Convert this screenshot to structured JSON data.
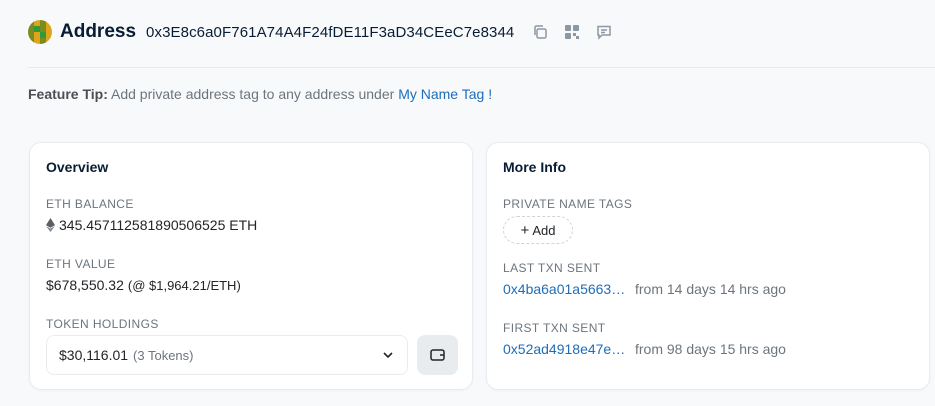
{
  "header": {
    "title": "Address",
    "address": "0x3E8c6a0F761A74A4F24fDE11F3aD34CEeC7e8344",
    "icons": [
      "copy-icon",
      "qr-code-icon",
      "comment-icon"
    ]
  },
  "feature_tip": {
    "label": "Feature Tip:",
    "text": "Add private address tag to any address under",
    "link": "My Name Tag",
    "suffix": "!"
  },
  "overview": {
    "title": "Overview",
    "eth_balance_label": "ETH BALANCE",
    "eth_balance": "345.457112581890506525 ETH",
    "eth_value_label": "ETH VALUE",
    "eth_value": "$678,550.32",
    "eth_price": "(@ $1,964.21/ETH)",
    "token_holdings_label": "TOKEN HOLDINGS",
    "token_amount": "$30,116.01",
    "token_count": "(3 Tokens)"
  },
  "more_info": {
    "title": "More Info",
    "private_tags_label": "PRIVATE NAME TAGS",
    "add_label": "Add",
    "last_txn_label": "LAST TXN SENT",
    "last_txn_hash": "0x4ba6a01a5663…",
    "last_txn_ago": "from 14 days 14 hrs ago",
    "first_txn_label": "FIRST TXN SENT",
    "first_txn_hash": "0x52ad4918e47e…",
    "first_txn_ago": "from 98 days 15 hrs ago"
  },
  "colors": {
    "link": "#1e6db8",
    "heading": "#081d35",
    "muted": "#6c757d",
    "background": "#f8f9fa"
  }
}
